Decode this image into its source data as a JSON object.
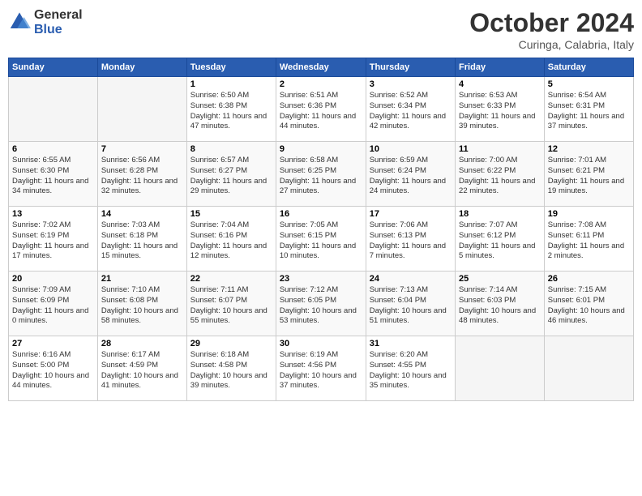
{
  "header": {
    "logo_general": "General",
    "logo_blue": "Blue",
    "title": "October 2024",
    "subtitle": "Curinga, Calabria, Italy"
  },
  "weekdays": [
    "Sunday",
    "Monday",
    "Tuesday",
    "Wednesday",
    "Thursday",
    "Friday",
    "Saturday"
  ],
  "weeks": [
    [
      {
        "day": "",
        "detail": ""
      },
      {
        "day": "",
        "detail": ""
      },
      {
        "day": "1",
        "detail": "Sunrise: 6:50 AM\nSunset: 6:38 PM\nDaylight: 11 hours and 47 minutes."
      },
      {
        "day": "2",
        "detail": "Sunrise: 6:51 AM\nSunset: 6:36 PM\nDaylight: 11 hours and 44 minutes."
      },
      {
        "day": "3",
        "detail": "Sunrise: 6:52 AM\nSunset: 6:34 PM\nDaylight: 11 hours and 42 minutes."
      },
      {
        "day": "4",
        "detail": "Sunrise: 6:53 AM\nSunset: 6:33 PM\nDaylight: 11 hours and 39 minutes."
      },
      {
        "day": "5",
        "detail": "Sunrise: 6:54 AM\nSunset: 6:31 PM\nDaylight: 11 hours and 37 minutes."
      }
    ],
    [
      {
        "day": "6",
        "detail": "Sunrise: 6:55 AM\nSunset: 6:30 PM\nDaylight: 11 hours and 34 minutes."
      },
      {
        "day": "7",
        "detail": "Sunrise: 6:56 AM\nSunset: 6:28 PM\nDaylight: 11 hours and 32 minutes."
      },
      {
        "day": "8",
        "detail": "Sunrise: 6:57 AM\nSunset: 6:27 PM\nDaylight: 11 hours and 29 minutes."
      },
      {
        "day": "9",
        "detail": "Sunrise: 6:58 AM\nSunset: 6:25 PM\nDaylight: 11 hours and 27 minutes."
      },
      {
        "day": "10",
        "detail": "Sunrise: 6:59 AM\nSunset: 6:24 PM\nDaylight: 11 hours and 24 minutes."
      },
      {
        "day": "11",
        "detail": "Sunrise: 7:00 AM\nSunset: 6:22 PM\nDaylight: 11 hours and 22 minutes."
      },
      {
        "day": "12",
        "detail": "Sunrise: 7:01 AM\nSunset: 6:21 PM\nDaylight: 11 hours and 19 minutes."
      }
    ],
    [
      {
        "day": "13",
        "detail": "Sunrise: 7:02 AM\nSunset: 6:19 PM\nDaylight: 11 hours and 17 minutes."
      },
      {
        "day": "14",
        "detail": "Sunrise: 7:03 AM\nSunset: 6:18 PM\nDaylight: 11 hours and 15 minutes."
      },
      {
        "day": "15",
        "detail": "Sunrise: 7:04 AM\nSunset: 6:16 PM\nDaylight: 11 hours and 12 minutes."
      },
      {
        "day": "16",
        "detail": "Sunrise: 7:05 AM\nSunset: 6:15 PM\nDaylight: 11 hours and 10 minutes."
      },
      {
        "day": "17",
        "detail": "Sunrise: 7:06 AM\nSunset: 6:13 PM\nDaylight: 11 hours and 7 minutes."
      },
      {
        "day": "18",
        "detail": "Sunrise: 7:07 AM\nSunset: 6:12 PM\nDaylight: 11 hours and 5 minutes."
      },
      {
        "day": "19",
        "detail": "Sunrise: 7:08 AM\nSunset: 6:11 PM\nDaylight: 11 hours and 2 minutes."
      }
    ],
    [
      {
        "day": "20",
        "detail": "Sunrise: 7:09 AM\nSunset: 6:09 PM\nDaylight: 11 hours and 0 minutes."
      },
      {
        "day": "21",
        "detail": "Sunrise: 7:10 AM\nSunset: 6:08 PM\nDaylight: 10 hours and 58 minutes."
      },
      {
        "day": "22",
        "detail": "Sunrise: 7:11 AM\nSunset: 6:07 PM\nDaylight: 10 hours and 55 minutes."
      },
      {
        "day": "23",
        "detail": "Sunrise: 7:12 AM\nSunset: 6:05 PM\nDaylight: 10 hours and 53 minutes."
      },
      {
        "day": "24",
        "detail": "Sunrise: 7:13 AM\nSunset: 6:04 PM\nDaylight: 10 hours and 51 minutes."
      },
      {
        "day": "25",
        "detail": "Sunrise: 7:14 AM\nSunset: 6:03 PM\nDaylight: 10 hours and 48 minutes."
      },
      {
        "day": "26",
        "detail": "Sunrise: 7:15 AM\nSunset: 6:01 PM\nDaylight: 10 hours and 46 minutes."
      }
    ],
    [
      {
        "day": "27",
        "detail": "Sunrise: 6:16 AM\nSunset: 5:00 PM\nDaylight: 10 hours and 44 minutes."
      },
      {
        "day": "28",
        "detail": "Sunrise: 6:17 AM\nSunset: 4:59 PM\nDaylight: 10 hours and 41 minutes."
      },
      {
        "day": "29",
        "detail": "Sunrise: 6:18 AM\nSunset: 4:58 PM\nDaylight: 10 hours and 39 minutes."
      },
      {
        "day": "30",
        "detail": "Sunrise: 6:19 AM\nSunset: 4:56 PM\nDaylight: 10 hours and 37 minutes."
      },
      {
        "day": "31",
        "detail": "Sunrise: 6:20 AM\nSunset: 4:55 PM\nDaylight: 10 hours and 35 minutes."
      },
      {
        "day": "",
        "detail": ""
      },
      {
        "day": "",
        "detail": ""
      }
    ]
  ]
}
